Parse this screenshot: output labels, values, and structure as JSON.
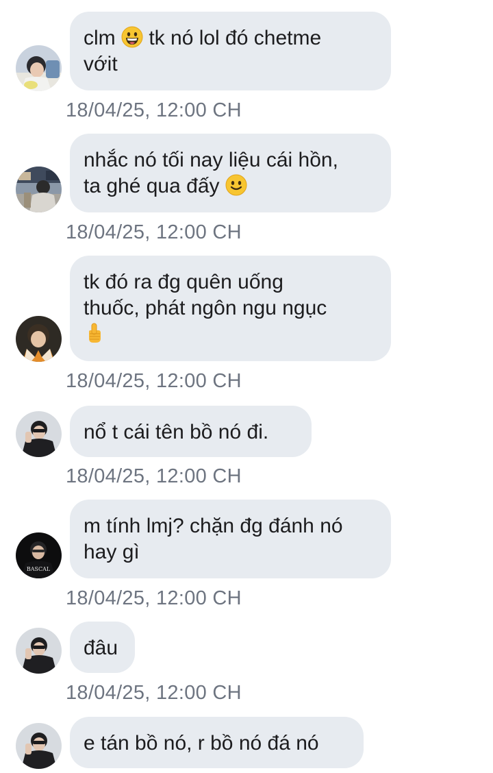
{
  "messages": [
    {
      "avatar": "avatar-user-a",
      "text_parts": [
        "clm ",
        " tk nó lol đó chetme\nvớit"
      ],
      "emoji": "grinning-face-icon",
      "timestamp": "18/04/25, 12:00 CH"
    },
    {
      "avatar": "avatar-user-b",
      "text_parts": [
        "nhắc nó tối nay liệu cái hồn,\nta ghé qua đấy ",
        ""
      ],
      "emoji": "slightly-smiling-face-icon",
      "timestamp": "18/04/25, 12:00 CH"
    },
    {
      "avatar": "avatar-user-c",
      "text_parts": [
        "tk đó ra đg quên uống\nthuốc, phát ngôn ngu ngục\n",
        ""
      ],
      "emoji": "pointing-up-hand-icon",
      "timestamp": "18/04/25, 12:00 CH"
    },
    {
      "avatar": "avatar-user-d",
      "text": "nổ t cái tên bồ nó đi.",
      "timestamp": "18/04/25, 12:00 CH"
    },
    {
      "avatar": "avatar-user-e",
      "text": "m tính lmj? chặn đg đánh nó\nhay gì",
      "timestamp": "18/04/25, 12:00 CH"
    },
    {
      "avatar": "avatar-user-d",
      "text": "đâu",
      "timestamp": "18/04/25, 12:00 CH"
    },
    {
      "avatar": "avatar-user-d",
      "text": "e tán bồ nó, r bồ nó đá nó"
    }
  ],
  "colors": {
    "bubble": "#e7ebf0",
    "timestamp": "#6d7480",
    "text": "#1c1c1e"
  }
}
